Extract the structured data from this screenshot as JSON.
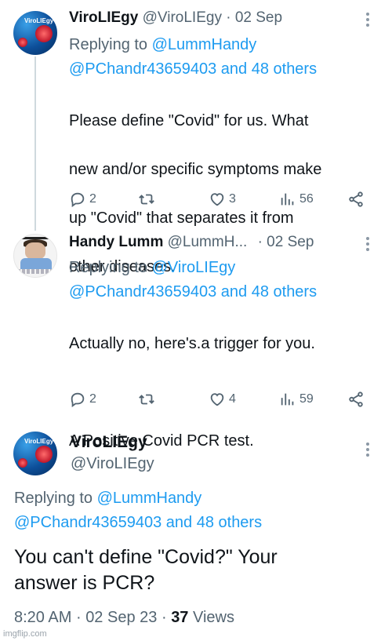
{
  "tweets": [
    {
      "name": "ViroLIEgy",
      "handle": "@ViroLIEgy",
      "dot": "·",
      "date": "02 Sep",
      "replying_prefix": "Replying to",
      "replying_to": "@LummHandy",
      "replying_more": "@PChandr43659403 and 48 others",
      "lines": [
        "Please define \"Covid\" for us. What",
        "new and/or specific symptoms make",
        "up \"Covid\" that separates it from",
        "other diseases."
      ],
      "replies": "2",
      "likes": "3",
      "views": "56"
    },
    {
      "name": "Handy Lumm",
      "handle": "@LummH...",
      "dot": "·",
      "date": "02 Sep",
      "replying_prefix": "Replying to",
      "replying_to": "@ViroLIEgy",
      "replying_more": "@PChandr43659403 and 48 others",
      "lines": [
        "Actually no, here's.a trigger for you.",
        "",
        "A Positive Covid PCR test."
      ],
      "replies": "2",
      "likes": "4",
      "views": "59"
    }
  ],
  "main": {
    "avatar_brand": "ViroLIEgy",
    "name": "ViroLIEgy",
    "handle": "@ViroLIEgy",
    "replying_prefix": "Replying to",
    "replying_to": "@LummHandy",
    "replying_more": "@PChandr43659403 and 48 others",
    "lines": [
      "You can't define \"Covid?\" Your",
      "answer is PCR?"
    ],
    "time": "8:20 AM",
    "dot": "·",
    "date": "02 Sep 23",
    "views_count": "37",
    "views_label": "Views"
  },
  "watermark": "imgflip.com",
  "icons": [
    "reply-icon",
    "retweet-icon",
    "like-icon",
    "views-icon",
    "share-icon",
    "more-icon"
  ]
}
